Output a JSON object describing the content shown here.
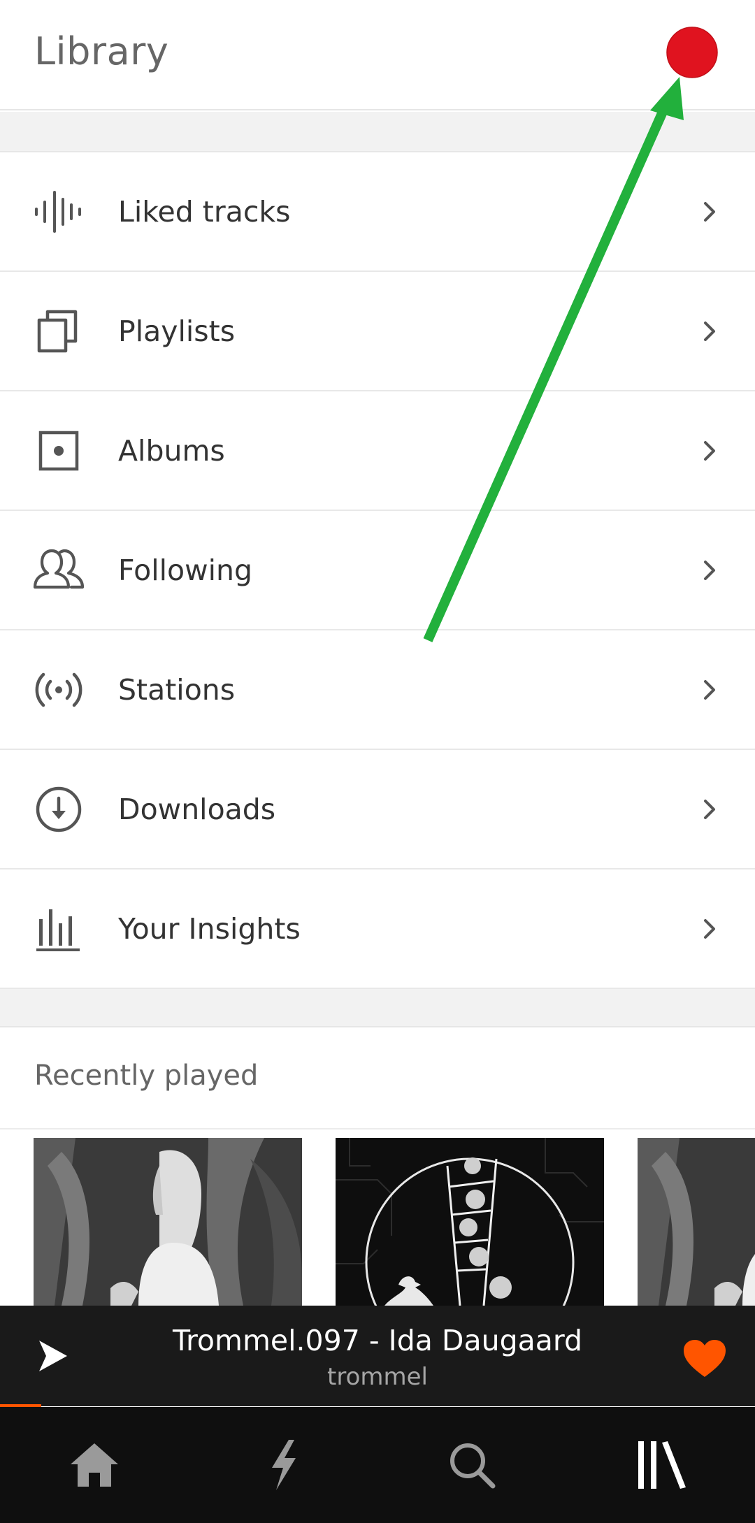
{
  "header": {
    "title": "Library"
  },
  "colors": {
    "accent": "#ff5500",
    "record_dot": "#e0131f",
    "annotation_arrow": "#22b03c",
    "like": "#ff5500"
  },
  "menu": [
    {
      "label": "Liked tracks",
      "icon": "waveform-icon"
    },
    {
      "label": "Playlists",
      "icon": "playlist-stack-icon"
    },
    {
      "label": "Albums",
      "icon": "album-icon"
    },
    {
      "label": "Following",
      "icon": "people-icon"
    },
    {
      "label": "Stations",
      "icon": "broadcast-icon"
    },
    {
      "label": "Downloads",
      "icon": "download-icon"
    },
    {
      "label": "Your Insights",
      "icon": "bar-chart-icon"
    }
  ],
  "recent": {
    "title": "Recently played"
  },
  "player": {
    "title": "Trommel.097 - Ida Daugaard",
    "artist": "trommel",
    "progress": 0.055,
    "liked": true
  },
  "tabs": [
    {
      "name": "home",
      "icon": "home-icon",
      "active": false
    },
    {
      "name": "stream",
      "icon": "lightning-icon",
      "active": false
    },
    {
      "name": "search",
      "icon": "search-icon",
      "active": false
    },
    {
      "name": "library",
      "icon": "library-icon",
      "active": true
    }
  ]
}
